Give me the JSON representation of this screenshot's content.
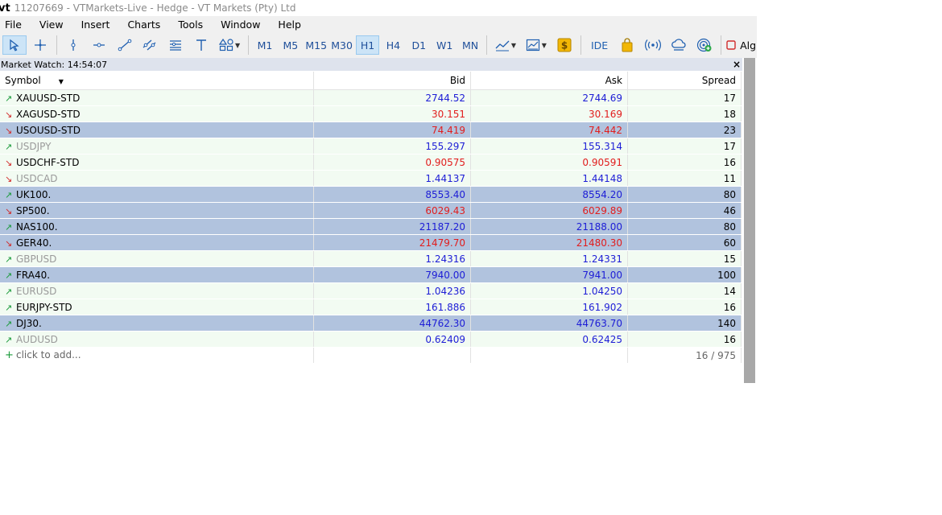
{
  "window": {
    "logo": "vt",
    "title": "11207669 - VTMarkets-Live - Hedge - VT Markets (Pty) Ltd"
  },
  "menu": [
    "File",
    "View",
    "Insert",
    "Charts",
    "Tools",
    "Window",
    "Help"
  ],
  "toolbar": {
    "timeframes": [
      "M1",
      "M5",
      "M15",
      "M30",
      "H1",
      "H4",
      "D1",
      "W1",
      "MN"
    ],
    "selected_timeframe": "H1",
    "ide_label": "IDE",
    "algo_label": "Alg",
    "icons": [
      "cursor-icon",
      "crosshair-icon",
      "vertical-line-icon",
      "horizontal-line-icon",
      "trendline-icon",
      "channel-icon",
      "fibonacci-icon",
      "text-icon",
      "shapes-icon",
      "indicators-icon",
      "templates-icon",
      "dollar-icon",
      "market-bag-icon",
      "signals-icon",
      "vps-cloud-icon",
      "radar-icon",
      "algo-stop-icon"
    ]
  },
  "market_watch": {
    "title": "Market Watch: 14:54:07",
    "close": "×",
    "columns": {
      "symbol": "Symbol",
      "bid": "Bid",
      "ask": "Ask",
      "spread": "Spread"
    },
    "rows": [
      {
        "symbol": "XAUUSD-STD",
        "dir": "up",
        "bid": "2744.52",
        "ask": "2744.69",
        "spread": "17",
        "bg": "light",
        "dim": false,
        "color": "blue"
      },
      {
        "symbol": "XAGUSD-STD",
        "dir": "down",
        "bid": "30.151",
        "ask": "30.169",
        "spread": "18",
        "bg": "light",
        "dim": false,
        "color": "red"
      },
      {
        "symbol": "USOUSD-STD",
        "dir": "down",
        "bid": "74.419",
        "ask": "74.442",
        "spread": "23",
        "bg": "dark",
        "dim": false,
        "color": "red"
      },
      {
        "symbol": "USDJPY",
        "dir": "up",
        "bid": "155.297",
        "ask": "155.314",
        "spread": "17",
        "bg": "light",
        "dim": true,
        "color": "blue"
      },
      {
        "symbol": "USDCHF-STD",
        "dir": "down",
        "bid": "0.90575",
        "ask": "0.90591",
        "spread": "16",
        "bg": "light",
        "dim": false,
        "color": "red"
      },
      {
        "symbol": "USDCAD",
        "dir": "down",
        "bid": "1.44137",
        "ask": "1.44148",
        "spread": "11",
        "bg": "light",
        "dim": true,
        "color": "blue"
      },
      {
        "symbol": "UK100.",
        "dir": "up",
        "bid": "8553.40",
        "ask": "8554.20",
        "spread": "80",
        "bg": "dark",
        "dim": false,
        "color": "blue"
      },
      {
        "symbol": "SP500.",
        "dir": "down",
        "bid": "6029.43",
        "ask": "6029.89",
        "spread": "46",
        "bg": "dark",
        "dim": false,
        "color": "red"
      },
      {
        "symbol": "NAS100.",
        "dir": "up",
        "bid": "21187.20",
        "ask": "21188.00",
        "spread": "80",
        "bg": "dark",
        "dim": false,
        "color": "blue"
      },
      {
        "symbol": "GER40.",
        "dir": "down",
        "bid": "21479.70",
        "ask": "21480.30",
        "spread": "60",
        "bg": "dark",
        "dim": false,
        "color": "red"
      },
      {
        "symbol": "GBPUSD",
        "dir": "up",
        "bid": "1.24316",
        "ask": "1.24331",
        "spread": "15",
        "bg": "light",
        "dim": true,
        "color": "blue"
      },
      {
        "symbol": "FRA40.",
        "dir": "up",
        "bid": "7940.00",
        "ask": "7941.00",
        "spread": "100",
        "bg": "dark",
        "dim": false,
        "color": "blue"
      },
      {
        "symbol": "EURUSD",
        "dir": "up",
        "bid": "1.04236",
        "ask": "1.04250",
        "spread": "14",
        "bg": "light",
        "dim": true,
        "color": "blue"
      },
      {
        "symbol": "EURJPY-STD",
        "dir": "up",
        "bid": "161.886",
        "ask": "161.902",
        "spread": "16",
        "bg": "light",
        "dim": false,
        "color": "blue"
      },
      {
        "symbol": "DJ30.",
        "dir": "up",
        "bid": "44762.30",
        "ask": "44763.70",
        "spread": "140",
        "bg": "dark",
        "dim": false,
        "color": "blue"
      },
      {
        "symbol": "AUDUSD",
        "dir": "up",
        "bid": "0.62409",
        "ask": "0.62425",
        "spread": "16",
        "bg": "light",
        "dim": true,
        "color": "blue"
      }
    ],
    "add_label": "click to add...",
    "count": "16 / 975"
  }
}
